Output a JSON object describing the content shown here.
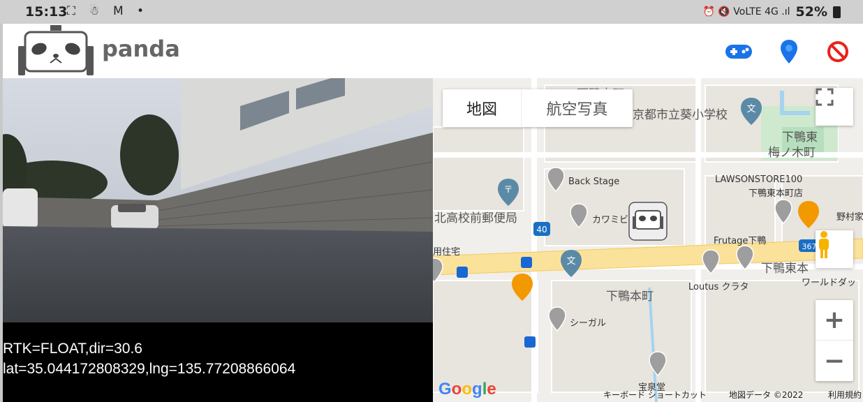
{
  "statusbar": {
    "time": "15:13",
    "left_icons": "⛶ ☃ M •",
    "right_icons": "⏰ 🔇 VoLTE 4G .ıl",
    "battery": "52%"
  },
  "app": {
    "title": "panda",
    "buttons": [
      {
        "name": "gamepad",
        "color": "#1a73e8"
      },
      {
        "name": "location",
        "color": "#1a73e8"
      },
      {
        "name": "stop",
        "color": "#e8231a"
      }
    ]
  },
  "telemetry": {
    "line1": "RTK=FLOAT,dir=30.6",
    "line2": "lat=35.044172808329,lng=135.77208866064"
  },
  "map": {
    "type_buttons": {
      "map": "地図",
      "satellite": "航空写真"
    },
    "labels": {
      "school": "京都市立葵小学校",
      "top_street": "下鴨本町",
      "shimogamo_higashi_1": "下鴨東",
      "shimogamo_higashi_2": "梅ノ木町",
      "back_stage": "Back Stage",
      "lawson": "LAWSONSTORE100",
      "lawson_sub": "下鴨東本町店",
      "post_office": "北高校前郵便局",
      "kawamibi": "カワミビ",
      "nomura": "野村家",
      "frutage": "Frutage下鴨",
      "jutaku": "用住宅",
      "shimogamo_higashi_mo": "下鴨東本",
      "loutus": "Loutus クラタ",
      "world": "ワールドダッ",
      "shimogamo_hon": "下鴨本町",
      "seagull": "シーガル",
      "housendo": "宝泉堂",
      "road40": "40",
      "road367": "367"
    },
    "footer": {
      "shortcuts": "キーボード ショートカット",
      "data": "地図データ ©2022",
      "terms": "利用規約"
    },
    "google": "Google",
    "controls": {
      "zoom_in": "+",
      "zoom_out": "−"
    }
  }
}
